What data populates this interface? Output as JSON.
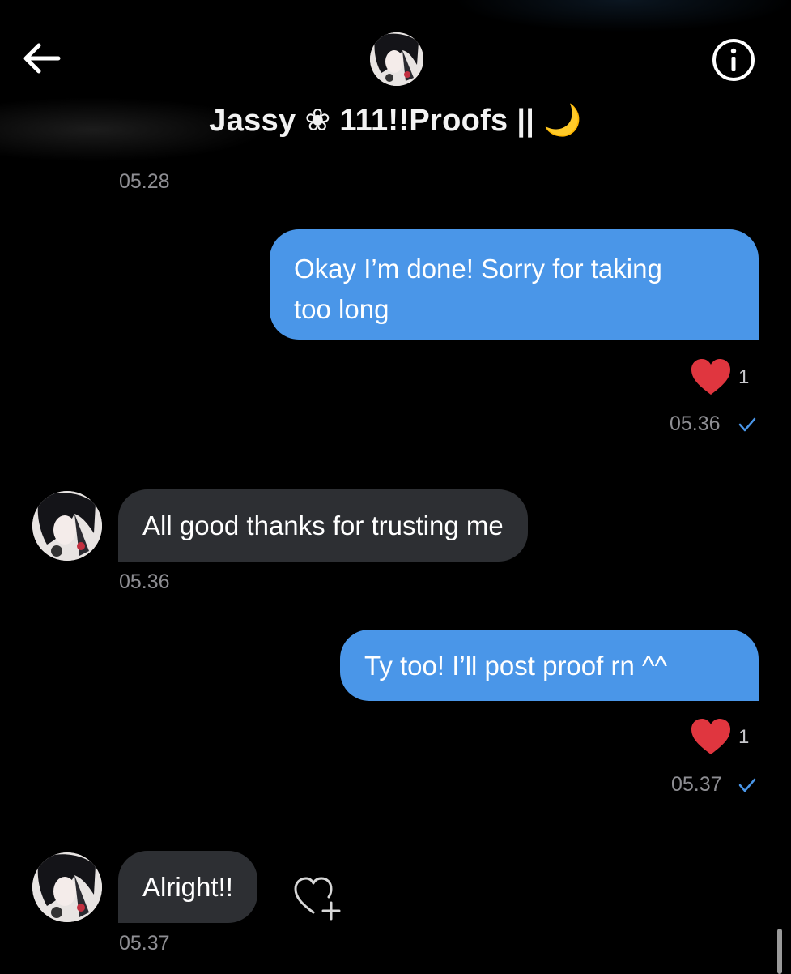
{
  "header": {
    "title": "Jassy ❀ 111!!Proofs || 🌙"
  },
  "messages": [
    {
      "id": "m0",
      "direction": "incoming",
      "text": "",
      "time": "05.28"
    },
    {
      "id": "m1",
      "direction": "outgoing",
      "lines": [
        "Okay I’m done! Sorry for taking",
        "too long"
      ],
      "reaction": "heart",
      "reaction_count": "1",
      "time": "05.36",
      "read": true
    },
    {
      "id": "m2",
      "direction": "incoming",
      "text": "All good thanks for trusting me",
      "time": "05.36"
    },
    {
      "id": "m3",
      "direction": "outgoing",
      "text": "Ty too! I’ll post proof rn ^^",
      "reaction": "heart",
      "reaction_count": "1",
      "time": "05.37",
      "read": true
    },
    {
      "id": "m4",
      "direction": "incoming",
      "text": "Alright!!",
      "time": "05.37"
    }
  ],
  "icons": {
    "back": "arrow-left-icon",
    "info": "info-circle-icon",
    "reaction": "heart-icon",
    "read_receipt": "checkmark-icon",
    "add_reaction": "heart-plus-icon"
  },
  "colors": {
    "background": "#000000",
    "outgoing_bubble": "#4a96e8",
    "incoming_bubble": "#2d2f33",
    "heart": "#e0363f",
    "timestamp": "#8e8e93",
    "read_check": "#4a96e8"
  }
}
